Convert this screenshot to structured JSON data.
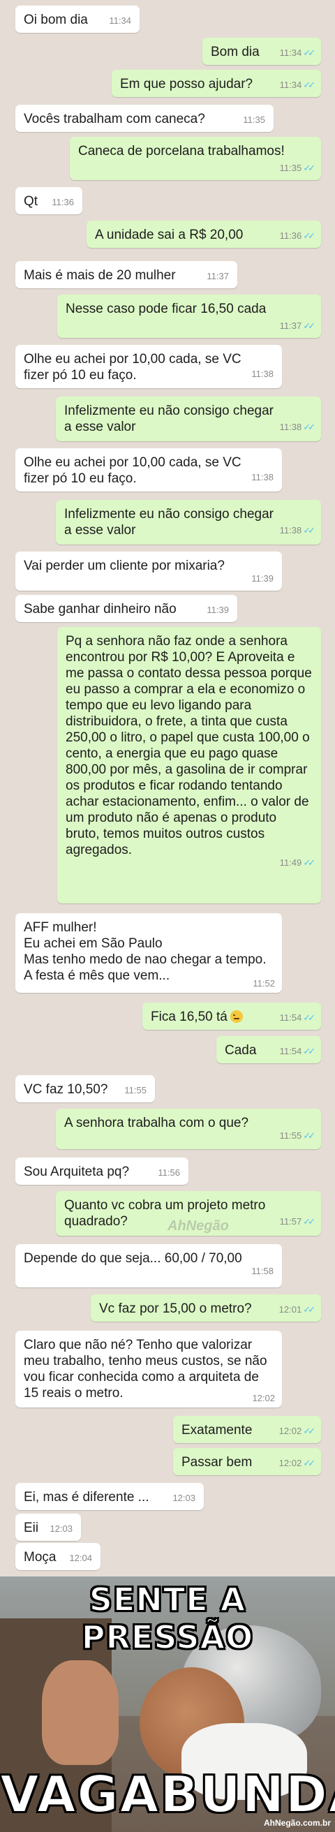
{
  "messages": [
    {
      "dir": "in",
      "text": "Oi bom dia",
      "time": "11:34"
    },
    {
      "dir": "out",
      "text": "Bom dia",
      "time": "11:34"
    },
    {
      "dir": "out",
      "text": "Em que posso ajudar?",
      "time": "11:34"
    },
    {
      "dir": "in",
      "text": "Vocês trabalham com caneca?",
      "time": "11:35"
    },
    {
      "dir": "out",
      "text": "Caneca de porcelana trabalhamos!",
      "time": "11:35"
    },
    {
      "dir": "in",
      "text": "Qt",
      "time": "11:36"
    },
    {
      "dir": "out",
      "text": "A unidade sai a R$ 20,00",
      "time": "11:36"
    },
    {
      "dir": "in",
      "text": "Mais é mais de 20 mulher",
      "time": "11:37"
    },
    {
      "dir": "out",
      "text": "Nesse caso pode ficar 16,50 cada",
      "time": "11:37"
    },
    {
      "dir": "in",
      "text": "Olhe eu achei por 10,00 cada, se VC fizer pó 10 eu faço.",
      "time": "11:38"
    },
    {
      "dir": "out",
      "text": "Infelizmente eu não consigo chegar a esse valor",
      "time": "11:38"
    },
    {
      "dir": "in",
      "text": "Olhe eu achei por 10,00 cada, se VC fizer pó 10 eu faço.",
      "time": "11:38"
    },
    {
      "dir": "out",
      "text": "Infelizmente eu não consigo chegar a esse valor",
      "time": "11:38"
    },
    {
      "dir": "in",
      "text": "Vai perder um cliente por mixaria?",
      "time": "11:39"
    },
    {
      "dir": "in",
      "text": "Sabe ganhar dinheiro não",
      "time": "11:39"
    },
    {
      "dir": "out",
      "text": "Pq a senhora não faz onde a senhora encontrou por R$ 10,00? E Aproveita e me passa o contato dessa pessoa porque eu passo a comprar a ela e economizo o tempo que eu levo ligando para distribuidora, o frete, a tinta que custa 250,00 o litro, o papel que custa 100,00 o cento, a energia que eu pago quase 800,00 por mês, a gasolina de ir comprar os produtos e ficar rodando tentando achar estacionamento, enfim... o valor de um produto não é apenas o produto bruto, temos muitos outros custos agregados.",
      "time": "11:49"
    },
    {
      "dir": "in",
      "text": "AFF mulher!\nEu achei em São Paulo\nMas tenho medo de nao chegar a tempo. A festa é mês que vem...",
      "time": "11:52"
    },
    {
      "dir": "out",
      "text": "Fica 16,50 tá",
      "time": "11:54",
      "emoji": "smirk-emoji"
    },
    {
      "dir": "out",
      "text": "Cada",
      "time": "11:54"
    },
    {
      "dir": "in",
      "text": "VC faz 10,50?",
      "time": "11:55"
    },
    {
      "dir": "out",
      "text": "A senhora trabalha com o que?",
      "time": "11:55"
    },
    {
      "dir": "in",
      "text": "Sou Arquiteta pq?",
      "time": "11:56"
    },
    {
      "dir": "out",
      "text": "Quanto vc cobra um projeto  metro quadrado?",
      "time": "11:57"
    },
    {
      "dir": "in",
      "text": "Depende do que seja... 60,00 / 70,00",
      "time": "11:58"
    },
    {
      "dir": "out",
      "text": "Vc faz por 15,00 o metro?",
      "time": "12:01"
    },
    {
      "dir": "in",
      "text": "Claro que não né? Tenho que valorizar meu trabalho, tenho meus custos, se não vou ficar conhecida como a arquiteta de 15 reais o metro.",
      "time": "12:02"
    },
    {
      "dir": "out",
      "text": "Exatamente",
      "time": "12:02"
    },
    {
      "dir": "out",
      "text": "Passar bem",
      "time": "12:02"
    },
    {
      "dir": "in",
      "text": "Ei, mas é diferente ...",
      "time": "12:03"
    },
    {
      "dir": "in",
      "text": "Eii",
      "time": "12:03"
    },
    {
      "dir": "in",
      "text": "Moça",
      "time": "12:04"
    }
  ],
  "watermark": "AhNegão",
  "meme": {
    "top_text": "SENTE A PRESSÃO",
    "bottom_text": "VAGABUNDA",
    "credit": "AhNegão.com.br"
  },
  "colors": {
    "background": "#e5ddd5",
    "incoming": "#ffffff",
    "outgoing": "#dcf8c6",
    "read_ticks": "#4fc3f7"
  }
}
